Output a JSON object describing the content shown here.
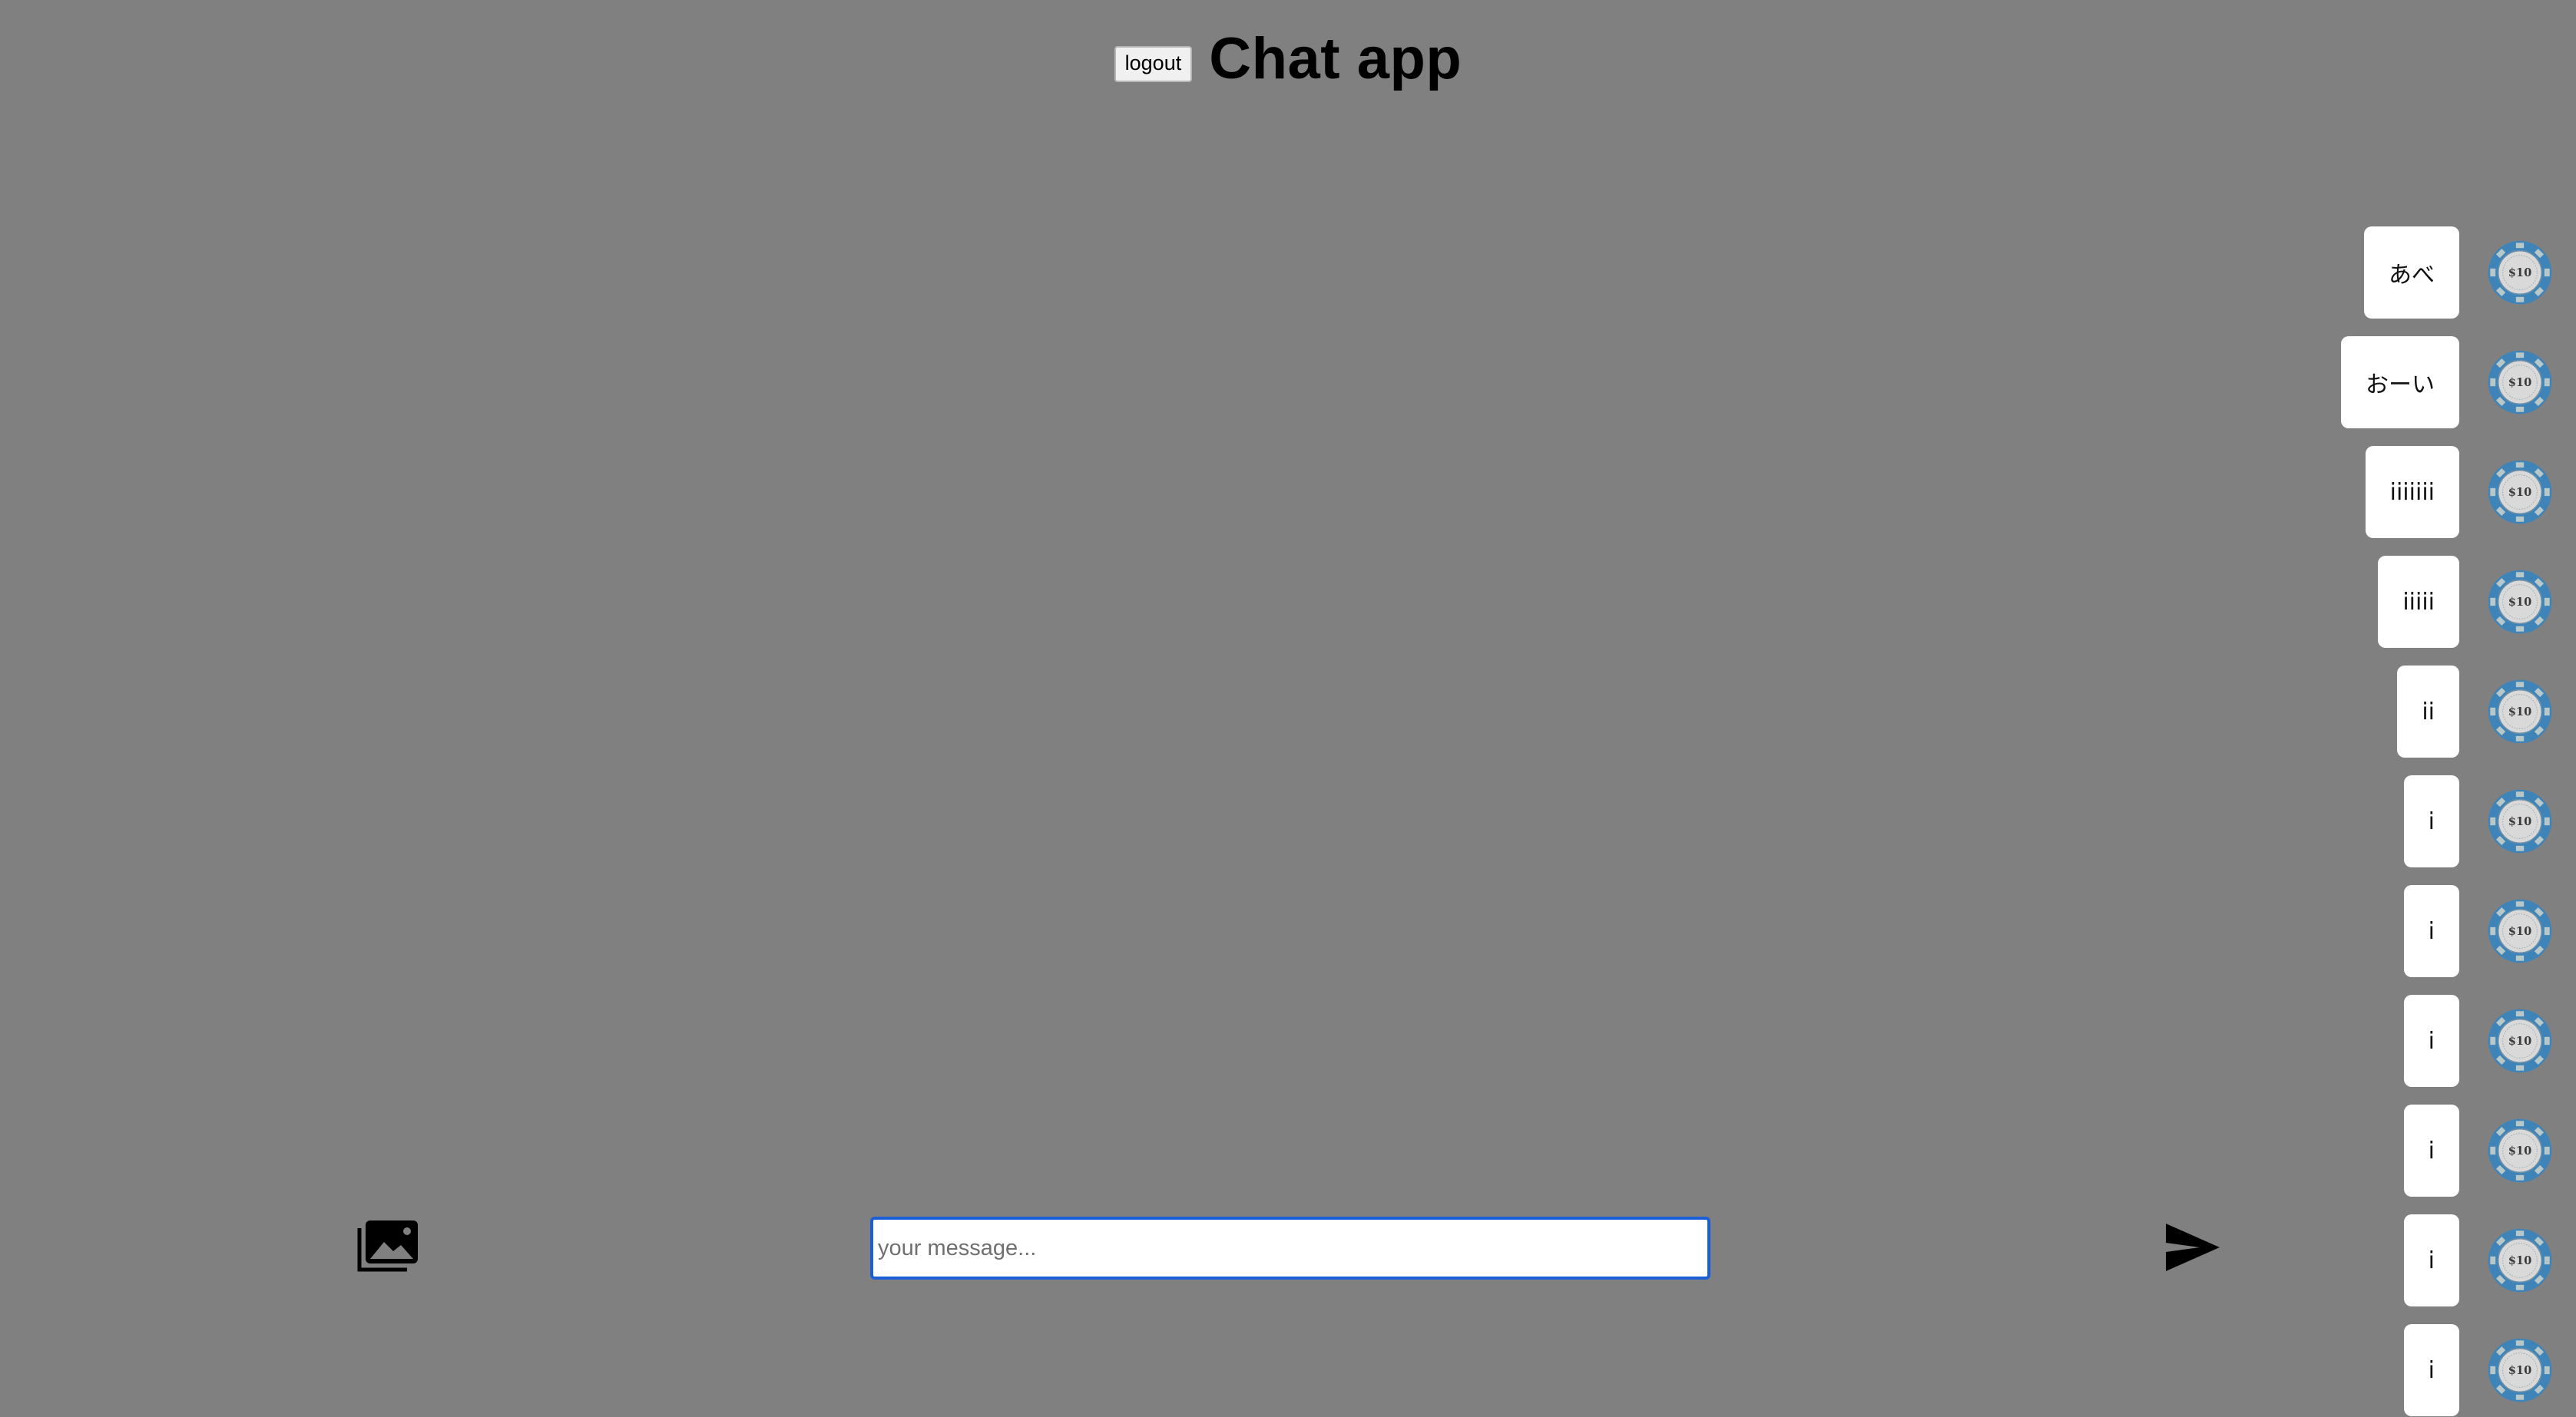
{
  "header": {
    "logout_label": "logout",
    "title": "Chat app"
  },
  "messages": [
    {
      "text": "あべ",
      "avatar_icon": "poker-chip-icon",
      "avatar_label": "$10"
    },
    {
      "text": "おーい",
      "avatar_icon": "poker-chip-icon",
      "avatar_label": "$10"
    },
    {
      "text": "iiiiiii",
      "avatar_icon": "poker-chip-icon",
      "avatar_label": "$10"
    },
    {
      "text": "iiiii",
      "avatar_icon": "poker-chip-icon",
      "avatar_label": "$10"
    },
    {
      "text": "ii",
      "avatar_icon": "poker-chip-icon",
      "avatar_label": "$10"
    },
    {
      "text": "i",
      "avatar_icon": "poker-chip-icon",
      "avatar_label": "$10"
    },
    {
      "text": "i",
      "avatar_icon": "poker-chip-icon",
      "avatar_label": "$10"
    },
    {
      "text": "i",
      "avatar_icon": "poker-chip-icon",
      "avatar_label": "$10"
    },
    {
      "text": "i",
      "avatar_icon": "poker-chip-icon",
      "avatar_label": "$10"
    },
    {
      "text": "i",
      "avatar_icon": "poker-chip-icon",
      "avatar_label": "$10"
    },
    {
      "text": "i",
      "avatar_icon": "poker-chip-icon",
      "avatar_label": "$10"
    }
  ],
  "composer": {
    "image_icon": "photo-library-icon",
    "input_value": "",
    "input_placeholder": "your message...",
    "send_icon": "send-icon"
  },
  "colors": {
    "background": "#808080",
    "bubble": "#ffffff",
    "input_focus_border": "#1b5fd6",
    "chip_blue": "#3f84b8",
    "chip_center": "#d9d9d9"
  }
}
